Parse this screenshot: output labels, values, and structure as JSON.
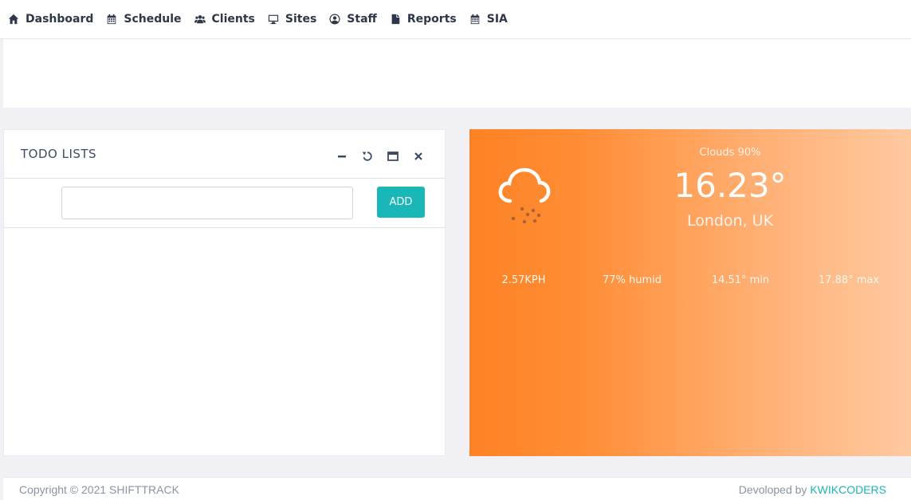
{
  "nav": {
    "items": [
      {
        "label": "Dashboard",
        "icon": "home-icon"
      },
      {
        "label": "Schedule",
        "icon": "calendar-icon"
      },
      {
        "label": "Clients",
        "icon": "users-icon"
      },
      {
        "label": "Sites",
        "icon": "monitor-icon"
      },
      {
        "label": "Staff",
        "icon": "user-circle-icon"
      },
      {
        "label": "Reports",
        "icon": "file-icon"
      },
      {
        "label": "SIA",
        "icon": "calendar-icon"
      }
    ]
  },
  "todo": {
    "title": "TODO LISTS",
    "input_value": "",
    "add_label": "ADD",
    "tools": [
      "minimize-icon",
      "refresh-icon",
      "maximize-icon",
      "close-icon"
    ]
  },
  "weather": {
    "description": "Clouds 90%",
    "temperature": "16.23°",
    "location": "London, UK",
    "wind": "2.57KPH",
    "humidity": "77% humid",
    "min": "14.51° min",
    "max": "17.88° max",
    "icon": "cloud-rain-icon",
    "gradient_start": "#fe8224",
    "gradient_end": "#ffc9a0"
  },
  "footer": {
    "copyright": "Copyright © 2021 SHIFTTRACK",
    "developed_prefix": "Devoloped by ",
    "developer": "KWIKCODERS",
    "accent": "#1ab7b8"
  }
}
